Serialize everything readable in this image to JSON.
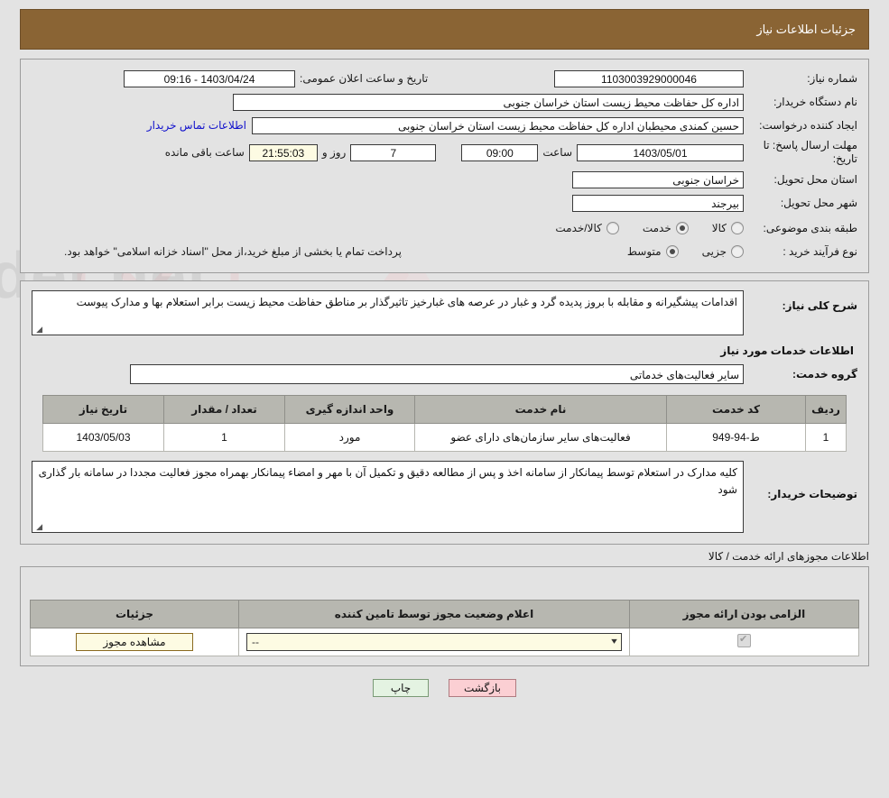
{
  "header": {
    "title": "جزئیات اطلاعات نیاز"
  },
  "need": {
    "number_label": "شماره نیاز:",
    "number_value": "1103003929000046",
    "announce_label": "تاریخ و ساعت اعلان عمومی:",
    "announce_value": "1403/04/24 - 09:16",
    "buyer_org_label": "نام دستگاه خریدار:",
    "buyer_org_value": "اداره کل حفاظت محیط زیست استان خراسان جنوبی",
    "creator_label": "ایجاد کننده درخواست:",
    "creator_value": "حسین کمندی محیطبان  اداره کل حفاظت محیط زیست استان خراسان جنوبی",
    "contact_link": "اطلاعات تماس خریدار",
    "deadline_label": "مهلت ارسال پاسخ: تا تاریخ:",
    "deadline_date": "1403/05/01",
    "time_label": "ساعت",
    "deadline_time": "09:00",
    "days_value": "7",
    "days_label": "روز و",
    "countdown_value": "21:55:03",
    "remaining_label": "ساعت باقی مانده",
    "province_label": "استان محل تحویل:",
    "province_value": "خراسان جنوبی",
    "city_label": "شهر محل تحویل:",
    "city_value": "بیرجند",
    "category_label": "طبقه بندی موضوعی:",
    "category_options": [
      {
        "label": "کالا",
        "selected": false
      },
      {
        "label": "خدمت",
        "selected": true
      },
      {
        "label": "کالا/خدمت",
        "selected": false
      }
    ],
    "process_label": "نوع فرآیند خرید :",
    "process_options": [
      {
        "label": "جزیی",
        "selected": false
      },
      {
        "label": "متوسط",
        "selected": true
      }
    ],
    "treasury_note": "پرداخت تمام یا بخشی از مبلغ خرید،از محل \"اسناد خزانه اسلامی\" خواهد بود."
  },
  "summary": {
    "label": "شرح کلی نیاز:",
    "value": "اقدامات پیشگیرانه و مقابله با بروز پدیده گرد و غبار در عرصه های  غبارخیز تاثیرگذار بر مناطق حفاظت محیط زیست   برابر استعلام بها و مدارک پیوست"
  },
  "services": {
    "caption": "اطلاعات خدمات مورد نیاز",
    "group_label": "گروه خدمت:",
    "group_value": "سایر فعالیت‌های خدماتی",
    "columns": [
      "ردیف",
      "کد خدمت",
      "نام خدمت",
      "واحد اندازه گیری",
      "تعداد / مقدار",
      "تاریخ نیاز"
    ],
    "rows": [
      {
        "index": "1",
        "code": "ط-94-949",
        "name": "فعالیت‌های سایر سازمان‌های دارای عضو",
        "unit": "مورد",
        "quantity": "1",
        "date": "1403/05/03"
      }
    ]
  },
  "buyer_notes": {
    "label": "توضیحات خریدار:",
    "value": "کلیه مدارک در استعلام توسط پیمانکار از سامانه اخذ و پس از مطالعه دقیق و تکمیل آن با مهر و امضاء پیمانکار بهمراه مجوز فعالیت مجددا در سامانه بار گذاری شود"
  },
  "licenses": {
    "caption": "اطلاعات مجوزهای ارائه خدمت / کالا",
    "columns": [
      "الزامی بودن ارائه مجوز",
      "اعلام وضعیت مجوز توسط تامین کننده",
      "جزئیات"
    ],
    "rows": [
      {
        "required_checked": true,
        "status_value": "--",
        "details_button": "مشاهده مجوز"
      }
    ]
  },
  "footer": {
    "print_label": "چاپ",
    "back_label": "بازگشت"
  },
  "colors": {
    "header_bar": "#8a6434",
    "page_background": "#e3e3e3",
    "link": "#1111cc",
    "table_header": "#b7b7b0",
    "cream_field": "#fdfbe3",
    "print_button": "#e4f3e2",
    "back_button": "#fbcfd3"
  }
}
